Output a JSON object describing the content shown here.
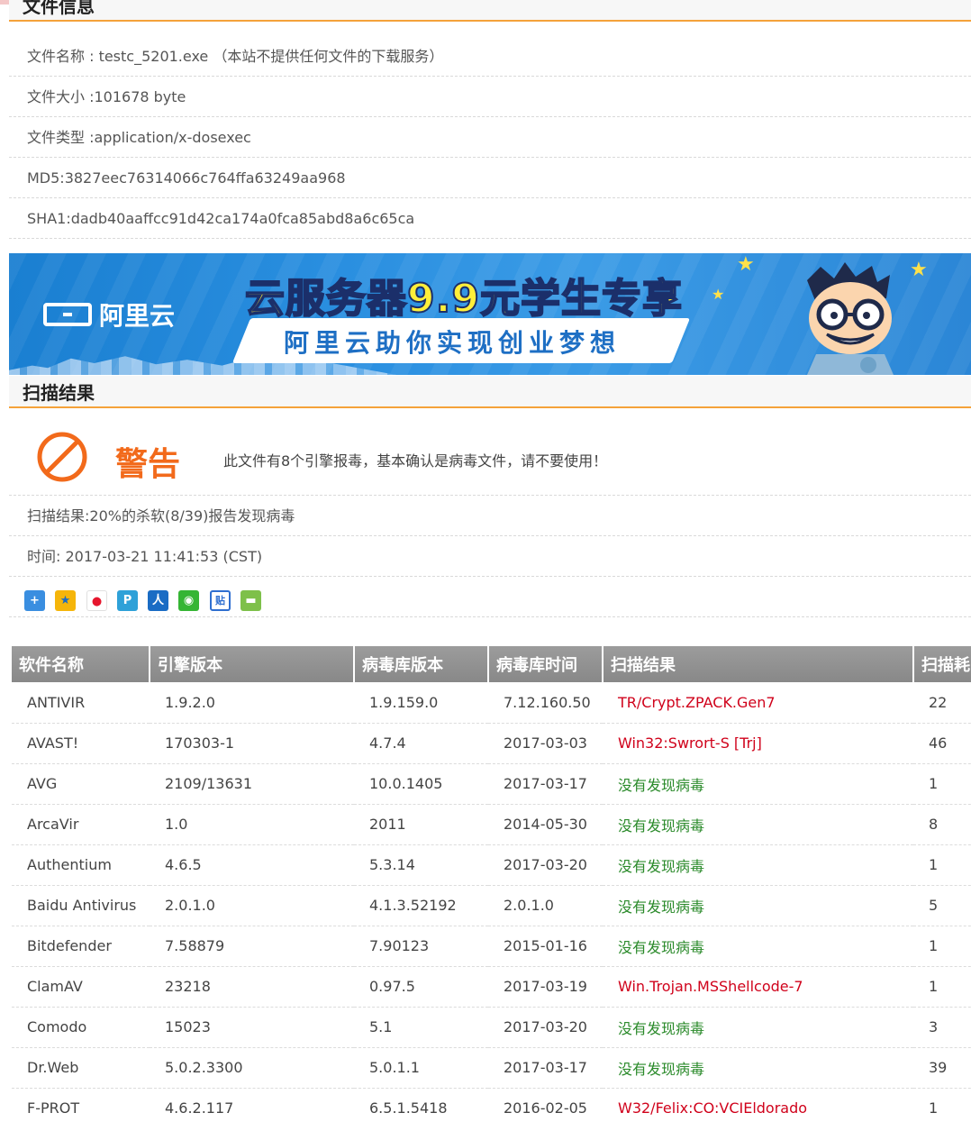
{
  "file_info": {
    "title": "文件信息",
    "rows": [
      "文件名称 : testc_5201.exe （本站不提供任何文件的下载服务）",
      "文件大小 :101678 byte",
      "文件类型 :application/x-dosexec",
      "MD5:3827eec76314066c764ffa63249aa968",
      "SHA1:dadb40aaffcc91d42ca174a0fca85abd8a6c65ca"
    ]
  },
  "banner": {
    "logo_text": "阿里云",
    "headline": "云服务器9.9元学生专享",
    "subline": "阿里云助你实现创业梦想",
    "colors": {
      "bg": "#2a8fe0",
      "headline": "#ffef3a"
    }
  },
  "scan": {
    "title": "扫描结果",
    "warning_label": "警告",
    "warning_text": "此文件有8个引擎报毒，基本确认是病毒文件，请不要使用！",
    "summary": "扫描结果:20%的杀软(8/39)报告发现病毒",
    "time": "时间: 2017-03-21 11:41:53 (CST)",
    "share_icons": [
      "qzone-add-icon",
      "qq-zone-icon",
      "weibo-icon",
      "tencent-weibo-icon",
      "renren-icon",
      "wechat-icon",
      "tieba-icon",
      "more-share-icon"
    ]
  },
  "table": {
    "headers": [
      "软件名称",
      "引擎版本",
      "病毒库版本",
      "病毒库时间",
      "扫描结果",
      "扫描耗时"
    ],
    "rows": [
      [
        "ANTIVIR",
        "1.9.2.0",
        "1.9.159.0",
        "7.12.160.50",
        "TR/Crypt.ZPACK.Gen7",
        "22"
      ],
      [
        "AVAST!",
        "170303-1",
        "4.7.4",
        "2017-03-03",
        "Win32:Swrort-S [Trj]",
        "46"
      ],
      [
        "AVG",
        "2109/13631",
        "10.0.1405",
        "2017-03-17",
        "没有发现病毒",
        "1"
      ],
      [
        "ArcaVir",
        "1.0",
        "2011",
        "2014-05-30",
        "没有发现病毒",
        "8"
      ],
      [
        "Authentium",
        "4.6.5",
        "5.3.14",
        "2017-03-20",
        "没有发现病毒",
        "1"
      ],
      [
        "Baidu Antivirus",
        "2.0.1.0",
        "4.1.3.52192",
        "2.0.1.0",
        "没有发现病毒",
        "5"
      ],
      [
        "Bitdefender",
        "7.58879",
        "7.90123",
        "2015-01-16",
        "没有发现病毒",
        "1"
      ],
      [
        "ClamAV",
        "23218",
        "0.97.5",
        "2017-03-19",
        "Win.Trojan.MSShellcode-7",
        "1"
      ],
      [
        "Comodo",
        "15023",
        "5.1",
        "2017-03-20",
        "没有发现病毒",
        "3"
      ],
      [
        "Dr.Web",
        "5.0.2.3300",
        "5.0.1.1",
        "2017-03-17",
        "没有发现病毒",
        "39"
      ],
      [
        "F-PROT",
        "4.6.2.117",
        "6.5.1.5418",
        "2016-02-05",
        "W32/Felix:CO:VCIEldorado",
        "1"
      ]
    ],
    "colors": {
      "detected": "#d0021b",
      "clean": "#2a8a2a",
      "header_bg": "#9c9c9c"
    }
  }
}
